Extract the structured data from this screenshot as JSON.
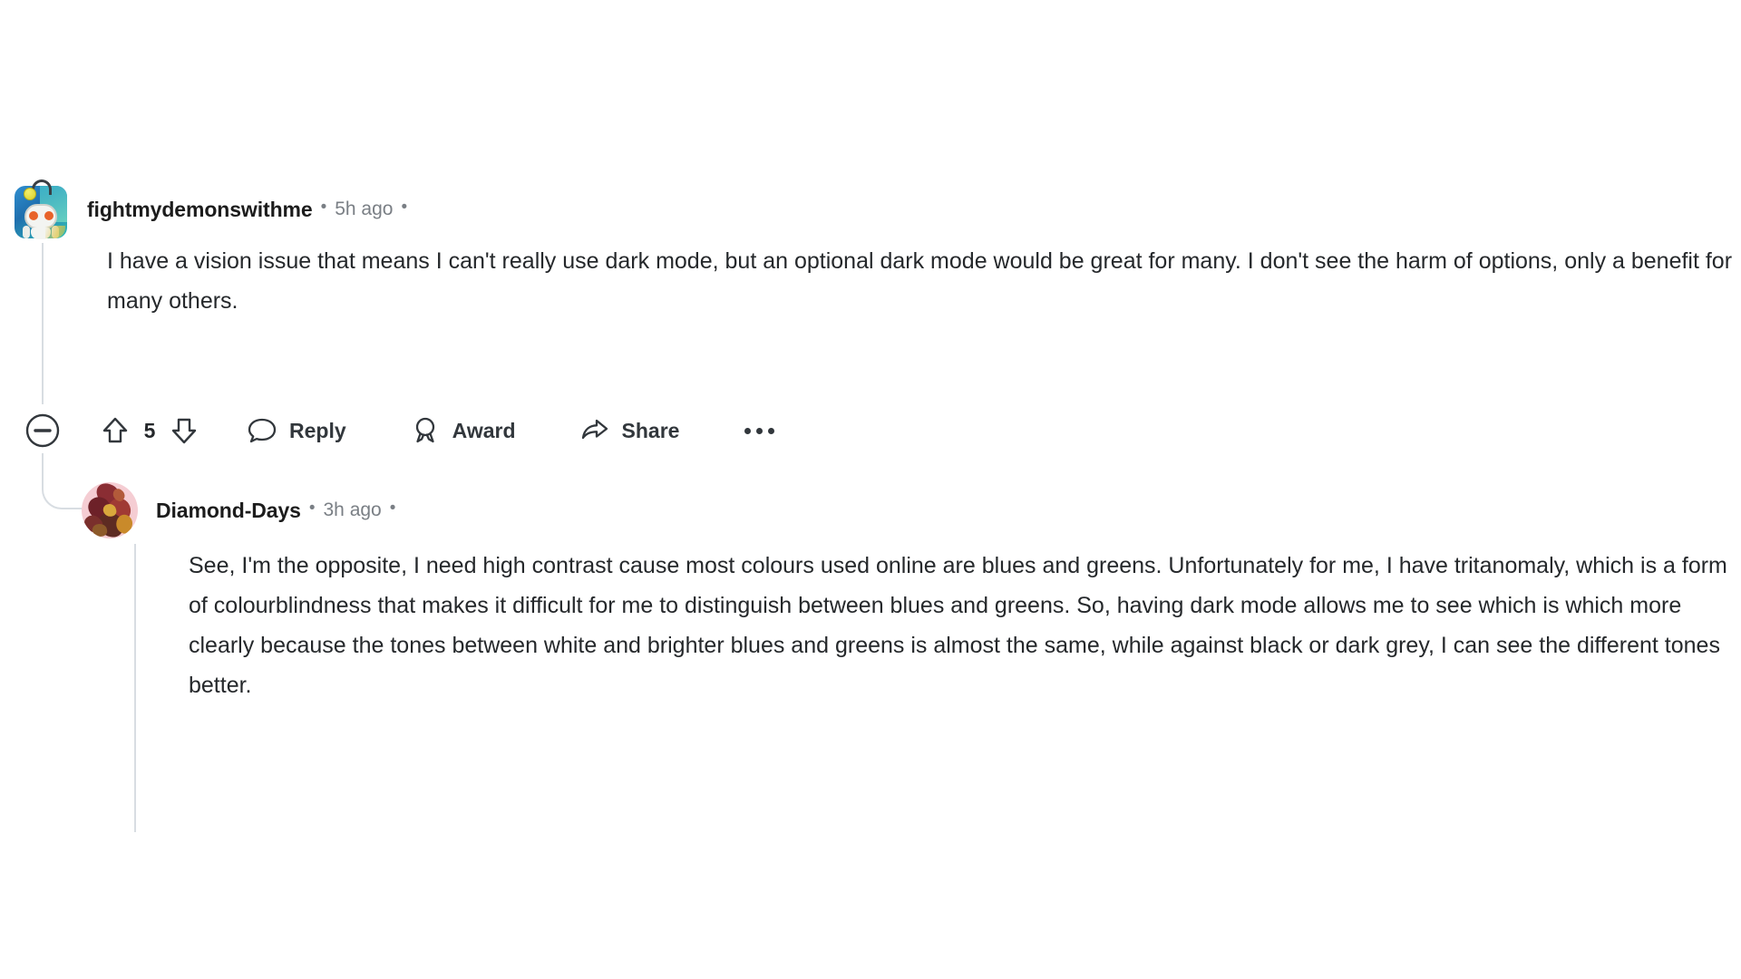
{
  "page": {
    "background_color": "#ffffff",
    "platform": "reddit-comment-thread"
  },
  "comments": [
    {
      "id": "comment-1",
      "depth": 0,
      "author": "fightmydemonswithme",
      "separator": "•",
      "timestamp": "5h ago",
      "avatar_type": "snoo-avatar",
      "body": "I have a vision issue that means I can't really use dark mode, but an optional dark mode would be great for many. I don't see the harm of options, only a benefit for many others.",
      "score": "5",
      "actions": {
        "collapse_icon": "collapse-minus-circle-icon",
        "upvote_icon": "upvote-arrow-icon",
        "downvote_icon": "downvote-arrow-icon",
        "reply_icon": "comment-bubble-icon",
        "reply_label": "Reply",
        "award_icon": "award-medal-icon",
        "award_label": "Award",
        "share_icon": "share-arrow-icon",
        "share_label": "Share",
        "overflow_icon": "overflow-ellipsis-icon"
      }
    },
    {
      "id": "comment-2",
      "depth": 1,
      "author": "Diamond-Days",
      "separator": "•",
      "timestamp": "3h ago",
      "avatar_type": "pink-floral-avatar",
      "body": "See, I'm the opposite, I need high contrast cause most colours used online are blues and greens. Unfortunately for me, I have tritanomaly, which is a form of colourblindness that makes it difficult for me to distinguish between blues and greens. So, having dark mode allows me to see which is which more clearly because the tones between white and brighter blues and greens is almost the same, while against black or dark grey, I can see the different tones better."
    }
  ],
  "colors": {
    "text_primary": "#25282b",
    "text_secondary": "#7a7f85",
    "username": "#1c1c1c",
    "action_icon": "#32373c",
    "thread_line": "#d8dde2"
  }
}
